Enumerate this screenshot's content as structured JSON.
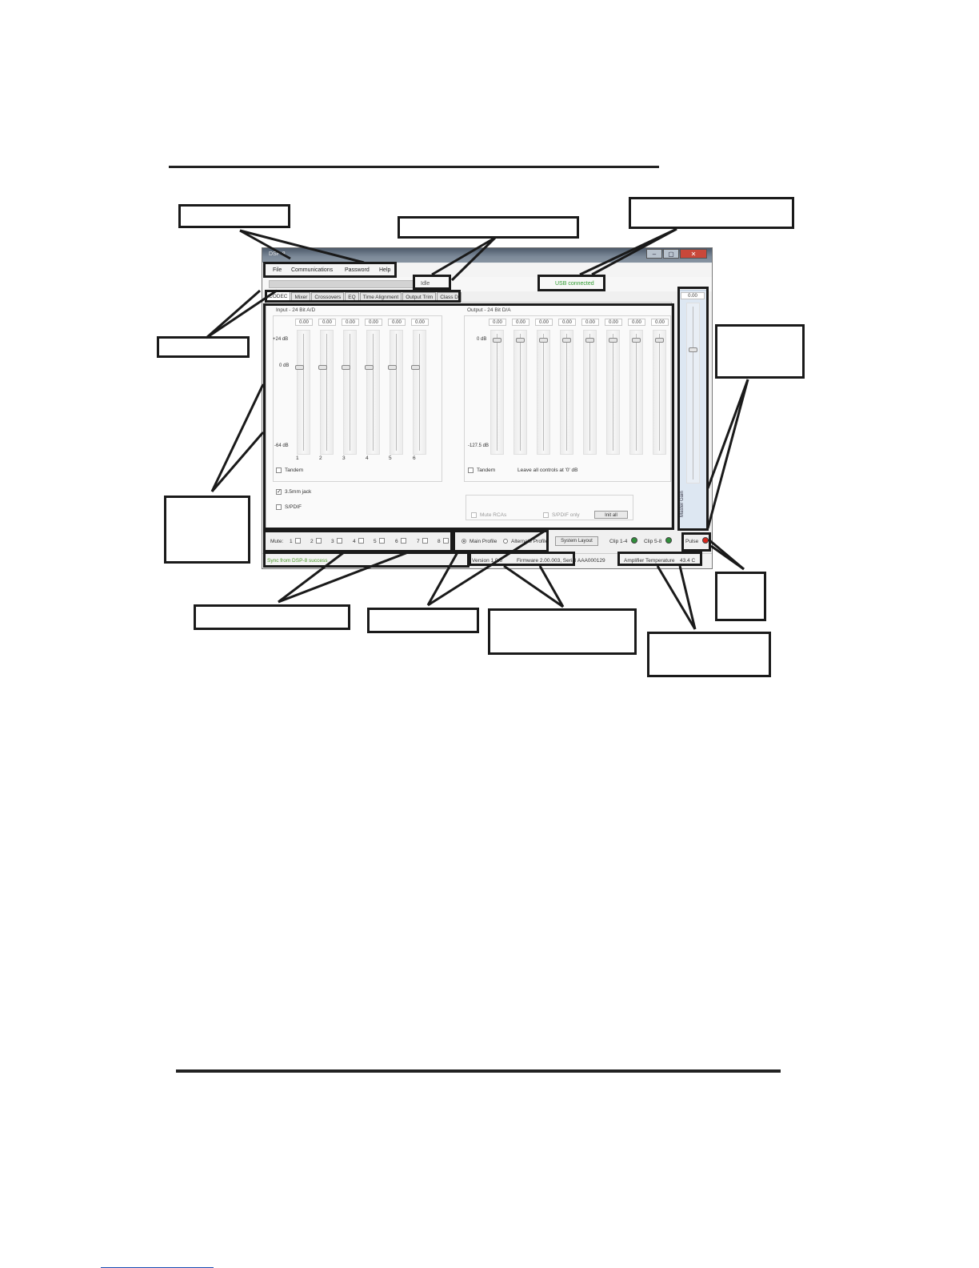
{
  "app": {
    "menu": [
      "File",
      "Communications",
      "Password",
      "Help"
    ],
    "status_idle": "Idle",
    "status_usb": "USB connected",
    "tabs": [
      "CODEC",
      "Mixer",
      "Crossovers",
      "EQ",
      "Time Alignment",
      "Output Trim",
      "Class D"
    ],
    "active_tab": "CODEC",
    "input": {
      "title": "Input - 24 Bit A/D",
      "values": [
        "0.00",
        "0.00",
        "0.00",
        "0.00",
        "0.00",
        "0.00"
      ],
      "scale_top": "+24 dB",
      "scale_mid": "0 dB",
      "scale_bottom": "-64 dB",
      "channels": [
        "1",
        "2",
        "3",
        "4",
        "5",
        "6"
      ],
      "tandem": "Tandem",
      "jack": "3.5mm jack",
      "spdif": "S/PDIF"
    },
    "output": {
      "title": "Output - 24 Bit D/A",
      "values": [
        "0.00",
        "0.00",
        "0.00",
        "0.00",
        "0.00",
        "0.00",
        "0.00",
        "0.00"
      ],
      "scale_top": "0 dB",
      "scale_bottom": "-127.5 dB",
      "tandem": "Tandem",
      "note": "Leave all controls at '0' dB",
      "mute_rca": "Mute RCAs",
      "spdif_only": "S/PDIF only",
      "init_all": "Init all"
    },
    "master": {
      "value": "0.00",
      "label": "Master Gain"
    },
    "bottom": {
      "mute_label": "Mute:",
      "mute_channels": [
        "1",
        "2",
        "3",
        "4",
        "5",
        "6",
        "7",
        "8"
      ],
      "main_profile": "Main Profile",
      "alternate_profile": "Alternate Profile",
      "system_layout": "System Layout",
      "clip_1_4": "Clip 1-4",
      "clip_5_8": "Clip 5-8",
      "pulse": "Pulse"
    },
    "statusbar": {
      "sync": "Sync from DSP-8 success",
      "version": "Version 1.0.6",
      "firmware": "Firmware 2.00.003, Serial AAA000129",
      "temp_label": "Amplifier Temperature",
      "temp_value": "43.4 C"
    },
    "colors": {
      "led_green": "#2f8f3a",
      "led_red": "#d9261c",
      "usb_text": "#2d9a2d",
      "sync_text": "#4c9a2a"
    }
  }
}
